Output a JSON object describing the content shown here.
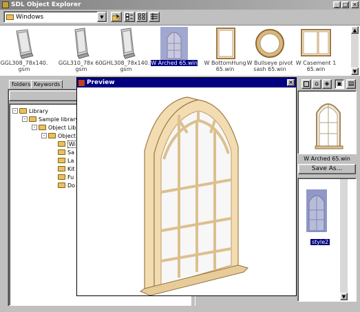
{
  "window": {
    "title": "SDL Object Explorer",
    "controls": [
      "_",
      "□",
      "×"
    ]
  },
  "combo": {
    "value": "Windows"
  },
  "thumbs": [
    {
      "name": "thumb-ggl308",
      "line1": "GGL308_78x140.",
      "line2": "gsm",
      "selected": false
    },
    {
      "name": "thumb-ggl310",
      "line1": "GGL310_78x 60.",
      "line2": "gsm",
      "selected": false
    },
    {
      "name": "thumb-ghl308",
      "line1": "GHL308_78x140.",
      "line2": "gsm",
      "selected": false
    },
    {
      "name": "thumb-arched",
      "line1": "W Arched 65.win",
      "line2": "",
      "selected": true
    },
    {
      "name": "thumb-bottomhung",
      "line1": "W BottomHung",
      "line2": "65.win",
      "selected": false
    },
    {
      "name": "thumb-bullseye",
      "line1": "W Bullseye pivot",
      "line2": "sash 65.win",
      "selected": false
    },
    {
      "name": "thumb-casement",
      "line1": "W Casement 1",
      "line2": "65.win",
      "selected": false
    }
  ],
  "tabs": {
    "folders": "folders",
    "keywords": "Keywords"
  },
  "tree": [
    {
      "label": "Library",
      "depth": 0,
      "toggle": "-"
    },
    {
      "label": "Sample library.l",
      "depth": 1,
      "toggle": "-"
    },
    {
      "label": "Object Libr",
      "depth": 2,
      "toggle": "-"
    },
    {
      "label": "Object",
      "depth": 3,
      "toggle": "-"
    },
    {
      "label": "Wi",
      "depth": 4,
      "toggle": "",
      "selected": true
    },
    {
      "label": "Sa",
      "depth": 4,
      "toggle": ""
    },
    {
      "label": "La",
      "depth": 4,
      "toggle": ""
    },
    {
      "label": "Kit",
      "depth": 4,
      "toggle": ""
    },
    {
      "label": "Fu",
      "depth": 4,
      "toggle": ""
    },
    {
      "label": "Do",
      "depth": 4,
      "toggle": ""
    }
  ],
  "preview": {
    "title": "Preview",
    "close": "×"
  },
  "details": {
    "name_label": "W Arched 65.win",
    "save_as": "Save As..."
  },
  "style": {
    "label": "style2"
  }
}
